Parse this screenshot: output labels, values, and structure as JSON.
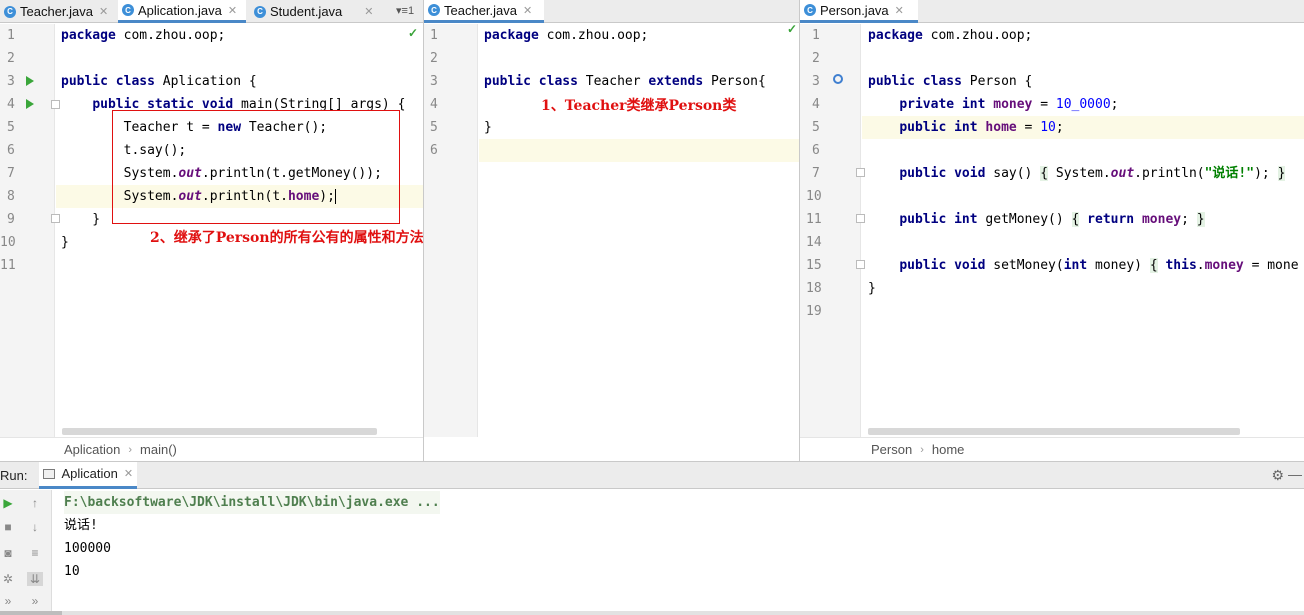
{
  "left_pane": {
    "tabs": [
      {
        "label": "Teacher.java"
      },
      {
        "label": "Aplication.java"
      },
      {
        "label": "Student.java"
      }
    ],
    "tab_overflow": "1",
    "line_numbers": [
      "1",
      "2",
      "3",
      "4",
      "5",
      "6",
      "7",
      "8",
      "9",
      "10",
      "11"
    ],
    "code": {
      "l1_kw": "package",
      "l1_rest": " com.zhou.oop;",
      "l3_kw1": "public",
      "l3_kw2": "class",
      "l3_rest": " Aplication {",
      "l4_indent": "    ",
      "l4_kw1": "public",
      "l4_kw2": "static",
      "l4_kw3": "void",
      "l4_rest": " main(String[] args) {",
      "l5_pre": "        Teacher t = ",
      "l5_kw": "new",
      "l5_rest": " Teacher();",
      "l6": "        t.say();",
      "l7_pre": "        System.",
      "l7_st": "out",
      "l7_rest": ".println(t.getMoney());",
      "l8_pre": "        System.",
      "l8_st": "out",
      "l8_mid": ".println(t.",
      "l8_fld": "home",
      "l8_rest": ");",
      "l9": "    }",
      "l10": "}"
    },
    "breadcrumb": [
      "Aplication",
      "main()"
    ],
    "annotation": "2、继承了Person的所有公有的属性和方法"
  },
  "mid_pane": {
    "tabs": [
      {
        "label": "Teacher.java"
      }
    ],
    "line_numbers": [
      "1",
      "2",
      "3",
      "4",
      "5",
      "6"
    ],
    "code": {
      "l1_kw": "package",
      "l1_rest": " com.zhou.oop;",
      "l3_kw1": "public",
      "l3_kw2": "class",
      "l3_mid": " Teacher ",
      "l3_kw3": "extends",
      "l3_rest": " Person{",
      "l5": "}"
    },
    "annotation": "1、Teacher类继承Person类"
  },
  "right_pane": {
    "tabs": [
      {
        "label": "Person.java"
      }
    ],
    "line_numbers": [
      "1",
      "2",
      "3",
      "4",
      "5",
      "6",
      "7",
      "10",
      "11",
      "14",
      "15",
      "18",
      "19"
    ],
    "code": {
      "l1_kw": "package",
      "l1_rest": " com.zhou.oop;",
      "l3_kw1": "public",
      "l3_kw2": "class",
      "l3_rest": " Person {",
      "l4_kw1": "private",
      "l4_kw2": "int",
      "l4_fld": "money",
      "l4_eq": " = ",
      "l4_num": "10_0000",
      "l4_end": ";",
      "l5_kw1": "public",
      "l5_kw2": "int",
      "l5_fld": "home",
      "l5_eq": " = ",
      "l5_num": "10",
      "l5_end": ";",
      "l7_kw1": "public",
      "l7_kw2": "void",
      "l7_mid": " say() ",
      "l7_b1": "{",
      "l7_pre": " System.",
      "l7_st": "out",
      "l7_call": ".println(",
      "l7_str": "\"说话!\"",
      "l7_end": "); ",
      "l7_b2": "}",
      "l11_kw1": "public",
      "l11_kw2": "int",
      "l11_mid": " getMoney() ",
      "l11_b1": "{",
      "l11_kw3": "return",
      "l11_fld": "money",
      "l11_end": "; ",
      "l11_b2": "}",
      "l15_kw1": "public",
      "l15_kw2": "void",
      "l15_mid": " setMoney(",
      "l15_kw3": "int",
      "l15_arg": " money) ",
      "l15_b1": "{",
      "l15_kw4": "this",
      "l15_dot": ".",
      "l15_fld": "money",
      "l15_rest": " = mone",
      "l18": "}"
    },
    "breadcrumb": [
      "Person",
      "home"
    ]
  },
  "run_panel": {
    "label": "Run:",
    "tab": "Aplication",
    "console": [
      "F:\\backsoftware\\JDK\\install\\JDK\\bin\\java.exe ...",
      "说话!",
      "100000",
      "10"
    ]
  }
}
